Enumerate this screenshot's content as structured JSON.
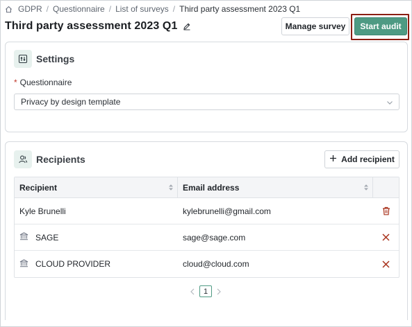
{
  "breadcrumb": {
    "items": [
      "GDPR",
      "Questionnaire",
      "List of surveys"
    ],
    "current": "Third party assessment 2023 Q1"
  },
  "header": {
    "title": "Third party assessment 2023 Q1",
    "manage_label": "Manage survey",
    "start_label": "Start audit"
  },
  "settings": {
    "title": "Settings",
    "questionnaire_label": "Questionnaire",
    "required_mark": "*",
    "questionnaire_value": "Privacy by design template"
  },
  "recipients": {
    "title": "Recipients",
    "add_label": "Add recipient",
    "columns": [
      "Recipient",
      "Email address"
    ],
    "rows": [
      {
        "name": "Kyle Brunelli",
        "email": "kylebrunelli@gmail.com",
        "type": "person",
        "action": "delete"
      },
      {
        "name": "SAGE",
        "email": "sage@sage.com",
        "type": "organization",
        "action": "remove"
      },
      {
        "name": "CLOUD PROVIDER",
        "email": "cloud@cloud.com",
        "type": "organization",
        "action": "remove"
      }
    ]
  },
  "pagination": {
    "current_page": "1"
  },
  "colors": {
    "accent": "#4e9a83",
    "danger": "#a8321c",
    "highlight_frame": "#8b1d12"
  }
}
